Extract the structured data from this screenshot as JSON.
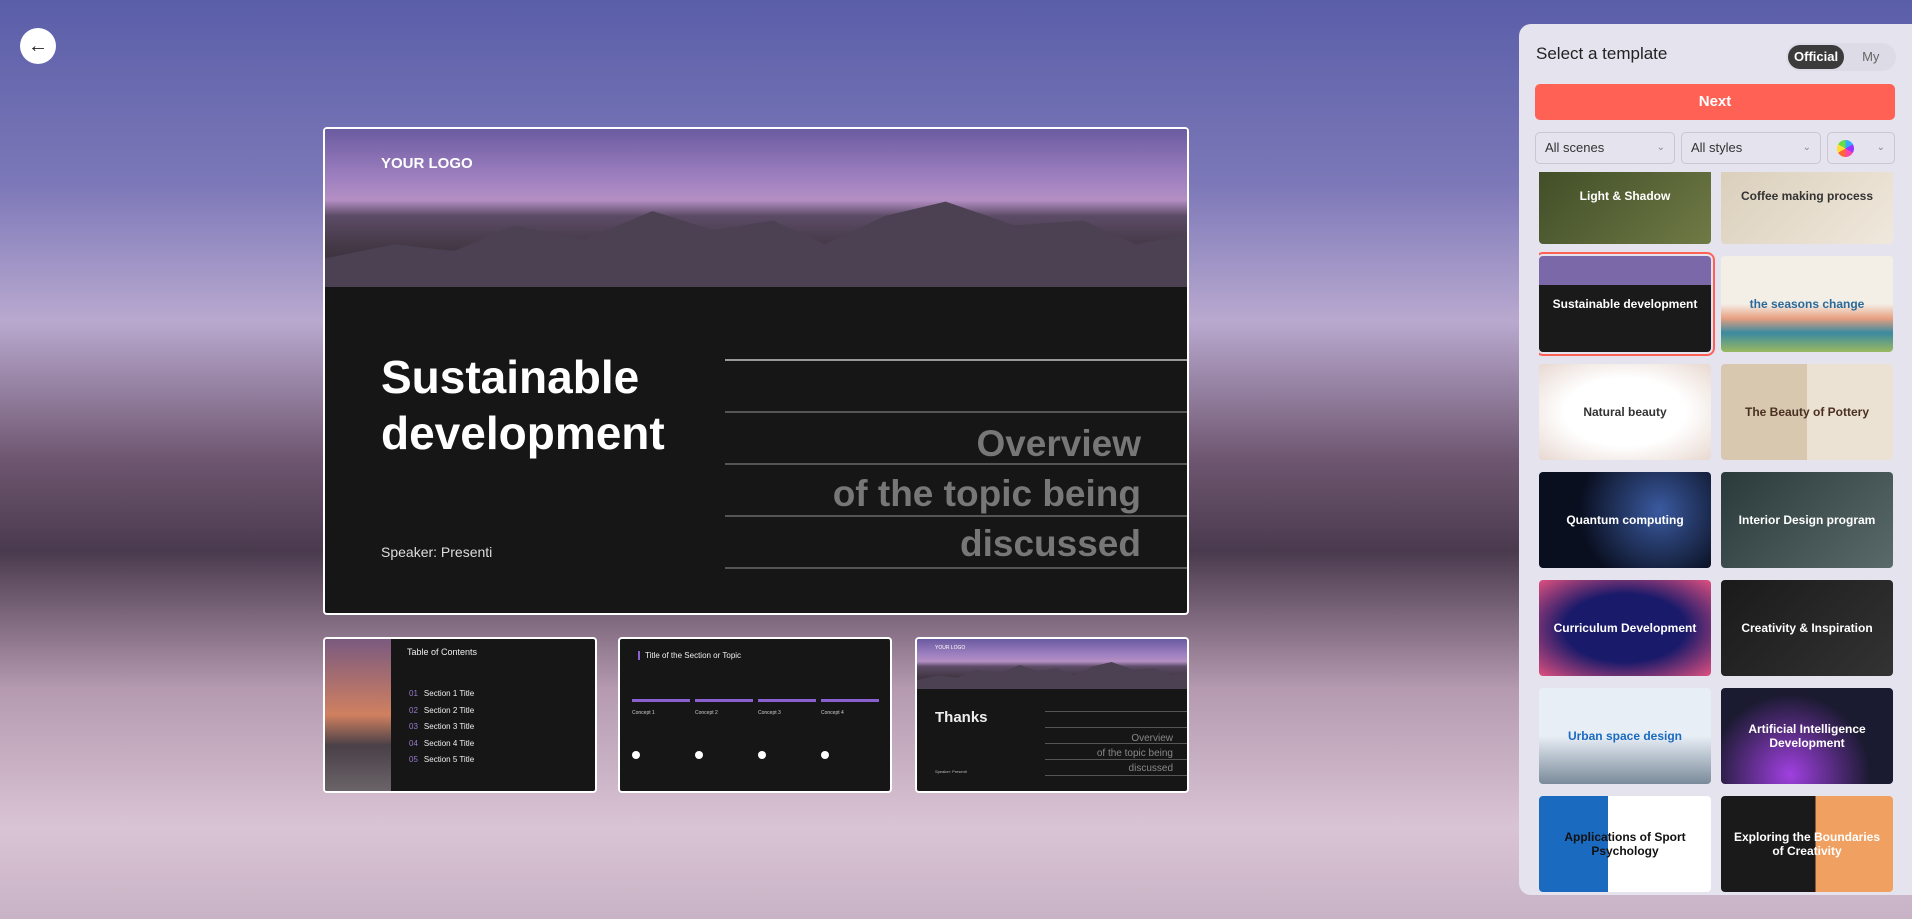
{
  "back_icon": "arrow-left-icon",
  "preview": {
    "logo": "YOUR LOGO",
    "title": "Sustainable development",
    "speaker": "Speaker: Presenti",
    "overview": [
      "Overview",
      "of the topic being",
      "discussed"
    ]
  },
  "slides": {
    "toc": {
      "title": "Table of Contents",
      "sections": [
        [
          "01",
          "Section 1 Title"
        ],
        [
          "02",
          "Section 2 Title"
        ],
        [
          "03",
          "Section 3 Title"
        ],
        [
          "04",
          "Section 4 Title"
        ],
        [
          "05",
          "Section 5 Title"
        ]
      ]
    },
    "section": {
      "title": "Title of the Section or Topic",
      "concepts": [
        "Concept 1",
        "Concept 2",
        "Concept 3",
        "Concept 4"
      ]
    },
    "thanks": {
      "logo": "YOUR LOGO",
      "title": "Thanks",
      "overview": [
        "Overview",
        "of the topic being",
        "discussed"
      ],
      "speaker": "Speaker: Presenti"
    }
  },
  "panel": {
    "title": "Select a template",
    "tabs": [
      "Official",
      "My"
    ],
    "active_tab": "Official",
    "next_label": "Next",
    "filters": {
      "scenes": "All scenes",
      "styles": "All styles",
      "color_icon": "color-wheel-icon"
    },
    "accent": "#ff6154",
    "templates": [
      "Light & Shadow",
      "Coffee making process",
      "Sustainable development",
      "the seasons change",
      "Natural beauty",
      "The Beauty of Pottery",
      "Quantum computing",
      "Interior Design program",
      "Curriculum Development",
      "Creativity & Inspiration",
      "Urban space design",
      "Artificial Intelligence Development",
      "Applications of Sport Psychology",
      "Exploring the Boundaries of Creativity"
    ],
    "selected": "Sustainable development"
  }
}
